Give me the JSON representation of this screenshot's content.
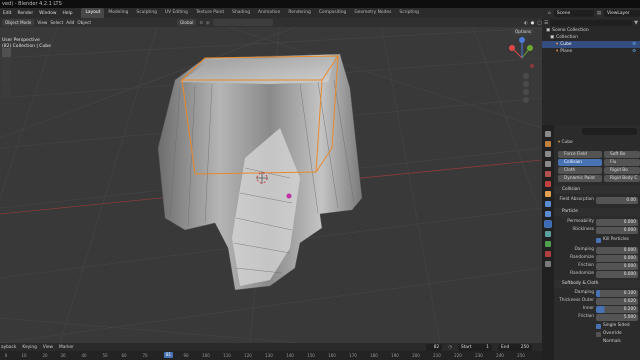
{
  "title": "ved) - Blender 4.2.1 LTS",
  "menu": [
    "Edit",
    "Render",
    "Window",
    "Help"
  ],
  "workspaces": [
    "Layout",
    "Modeling",
    "Sculpting",
    "UV Editing",
    "Texture Paint",
    "Shading",
    "Animation",
    "Rendering",
    "Compositing",
    "Geometry Nodes",
    "Scripting"
  ],
  "scene": "Scene",
  "view_layer": "ViewLayer",
  "viewport": {
    "mode": "Object Mode",
    "menus": [
      "View",
      "Select",
      "Add",
      "Object"
    ],
    "transform": "Global",
    "options": "Options",
    "info_line1": "User Perspective",
    "info_line2": "(82) Collection | Cube"
  },
  "outliner": {
    "search_placeholder": "",
    "items": [
      "Scene Collection",
      "Collection",
      "Cube",
      "Plane"
    ]
  },
  "properties": {
    "object": "Cube",
    "physics_buttons": [
      {
        "label": "Force Field",
        "on": false
      },
      {
        "label": "Soft Bo",
        "on": false
      },
      {
        "label": "Collision",
        "on": true
      },
      {
        "label": "Flu",
        "on": false
      },
      {
        "label": "Cloth",
        "on": false
      },
      {
        "label": "Rigid Bo",
        "on": false
      },
      {
        "label": "Dynamic Paint",
        "on": false
      },
      {
        "label": "Rigid Body C",
        "on": false
      }
    ],
    "collision_header": "Collision",
    "field_absorption_label": "Field Absorption",
    "field_absorption": "0.00",
    "particle_header": "Particle",
    "permeability_label": "Permeability",
    "permeability": "0.000",
    "stickiness_label": "Stickiness",
    "stickiness": "0.000",
    "kill_particles": "Kill Particles",
    "damping_label": "Damping",
    "damping": "0.000",
    "randomize_label": "Randomize",
    "randomize": "0.000",
    "friction_label": "Friction",
    "friction": "0.000",
    "randomize2_label": "Randomize",
    "randomize2": "0.000",
    "softbody_header": "Softbody & Cloth",
    "sb_damping_label": "Damping",
    "sb_damping": "0.100",
    "thickness_outer_label": "Thickness Outer",
    "thickness_outer": "0.020",
    "inner_label": "Inner",
    "inner": "0.200",
    "sb_friction_label": "Friction",
    "sb_friction": "5.000",
    "single_sided": "Single Sided",
    "override_normals": "Override Normals"
  },
  "timeline": {
    "menus": [
      "ayback",
      "Keying",
      "View",
      "Marker"
    ],
    "current_frame": "82",
    "current_frame_marker": "81",
    "start_label": "Start",
    "start": "1",
    "end_label": "End",
    "end": "250",
    "ruler": [
      "0",
      "10",
      "20",
      "30",
      "40",
      "50",
      "60",
      "70",
      "81",
      "90",
      "100",
      "110",
      "120",
      "130",
      "140",
      "150",
      "160",
      "170",
      "180",
      "190",
      "200",
      "210",
      "220",
      "230",
      "240",
      "250"
    ]
  }
}
